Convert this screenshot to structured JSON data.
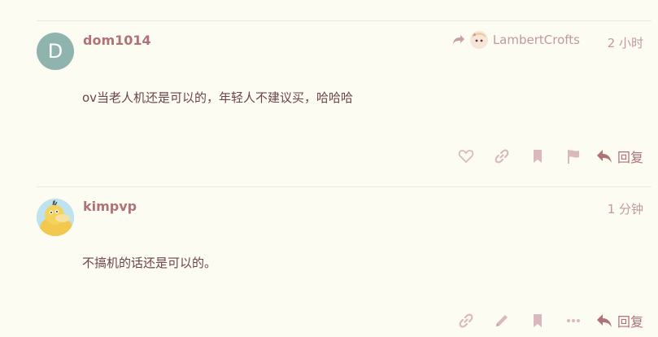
{
  "posts": [
    {
      "username": "dom1014",
      "avatar_letter": "D",
      "reply_to": "LambertCrofts",
      "time": "2 小时",
      "body": "ov当老人机还是可以的，年轻人不建议买，哈哈哈",
      "reply_label": "回复"
    },
    {
      "username": "kimpvp",
      "time": "1 分钟",
      "body": "不搞机的话还是可以的。",
      "reply_label": "回复"
    }
  ],
  "colors": {
    "background": "#fdfcf2",
    "accent": "#b07276",
    "icon": "#d9b9bb"
  }
}
